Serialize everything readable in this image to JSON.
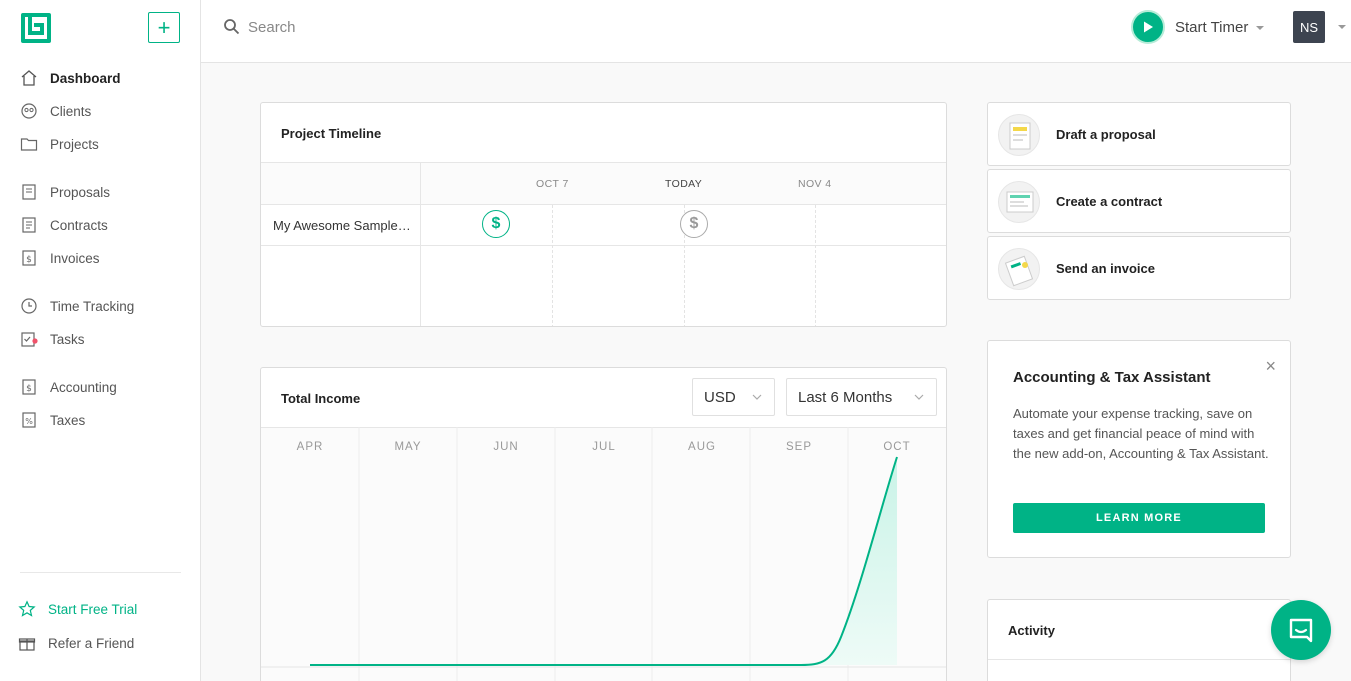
{
  "sidebar": {
    "logo": "bonsai-logo",
    "add_button": "+",
    "items": [
      {
        "label": "Dashboard",
        "icon": "home-icon",
        "active": true
      },
      {
        "label": "Clients",
        "icon": "clients-icon"
      },
      {
        "label": "Projects",
        "icon": "folder-icon"
      },
      {
        "label": "Proposals",
        "icon": "proposal-icon"
      },
      {
        "label": "Contracts",
        "icon": "contract-icon"
      },
      {
        "label": "Invoices",
        "icon": "invoice-icon"
      },
      {
        "label": "Time Tracking",
        "icon": "clock-icon"
      },
      {
        "label": "Tasks",
        "icon": "tasks-icon"
      },
      {
        "label": "Accounting",
        "icon": "accounting-icon"
      },
      {
        "label": "Taxes",
        "icon": "taxes-icon"
      }
    ],
    "footer": [
      {
        "label": "Start Free Trial",
        "icon": "star-icon"
      },
      {
        "label": "Refer a Friend",
        "icon": "gift-icon"
      }
    ]
  },
  "topbar": {
    "search_placeholder": "Search",
    "timer_label": "Start Timer",
    "avatar_initials": "NS"
  },
  "timeline": {
    "title": "Project Timeline",
    "dates": [
      "OCT 7",
      "TODAY",
      "NOV 4"
    ],
    "project": "My Awesome Sample Project",
    "marker_symbol": "$"
  },
  "income": {
    "title": "Total Income",
    "currency": "USD",
    "range": "Last 6 Months",
    "months": [
      "APR",
      "MAY",
      "JUN",
      "JUL",
      "AUG",
      "SEP",
      "OCT"
    ]
  },
  "actions": [
    {
      "label": "Draft a proposal",
      "icon": "proposal-thumb-icon"
    },
    {
      "label": "Create a contract",
      "icon": "contract-thumb-icon"
    },
    {
      "label": "Send an invoice",
      "icon": "invoice-thumb-icon"
    }
  ],
  "assistant": {
    "title": "Accounting & Tax Assistant",
    "body": "Automate your expense tracking, save on taxes and get financial peace of mind with the new add-on, Accounting & Tax Assistant.",
    "button": "LEARN MORE",
    "close": "×"
  },
  "activity": {
    "title": "Activity"
  },
  "colors": {
    "accent": "#00b386",
    "accent_light": "#d9f6ef",
    "sidebar_bg": "#ffffff",
    "avatar_bg": "#3d4450"
  }
}
